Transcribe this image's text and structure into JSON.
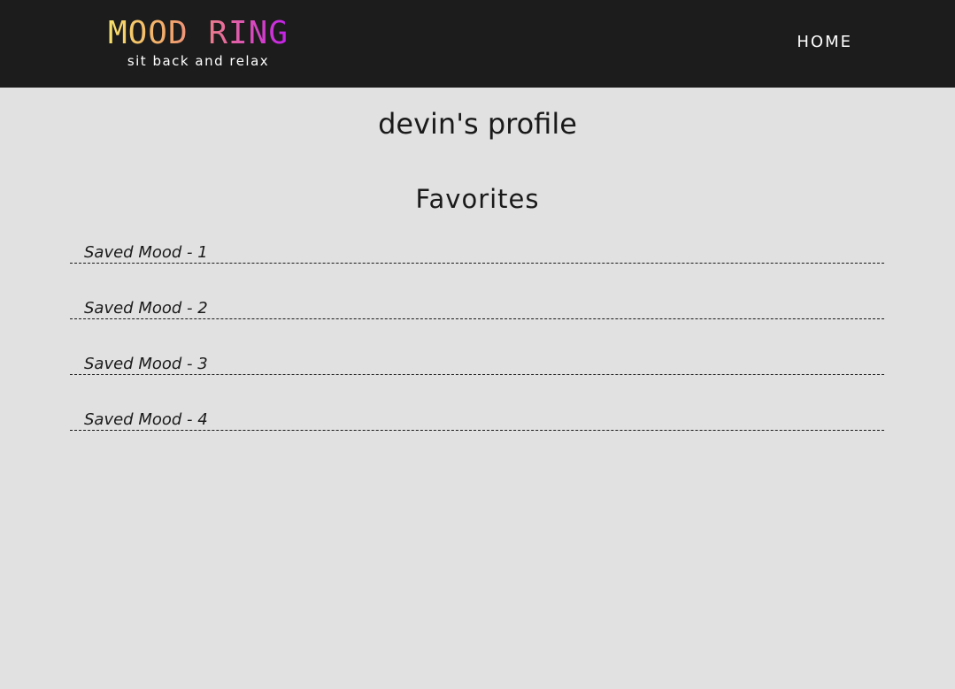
{
  "header": {
    "brand_title": "MOOD RING",
    "brand_tagline": "sit back and relax",
    "nav_home": "HOME",
    "bar_color": "#1c1c1c",
    "brand_gradient": [
      "#f7e36a",
      "#f2a56b",
      "#e66a9c",
      "#c21cf0"
    ]
  },
  "profile": {
    "title": "devin's profile"
  },
  "favorites": {
    "heading": "Favorites",
    "items": [
      {
        "label": "Saved Mood - 1"
      },
      {
        "label": "Saved Mood - 2"
      },
      {
        "label": "Saved Mood - 3"
      },
      {
        "label": "Saved Mood - 4"
      }
    ]
  },
  "colors": {
    "background": "#e1e1e1",
    "text": "#1a1a1a"
  }
}
